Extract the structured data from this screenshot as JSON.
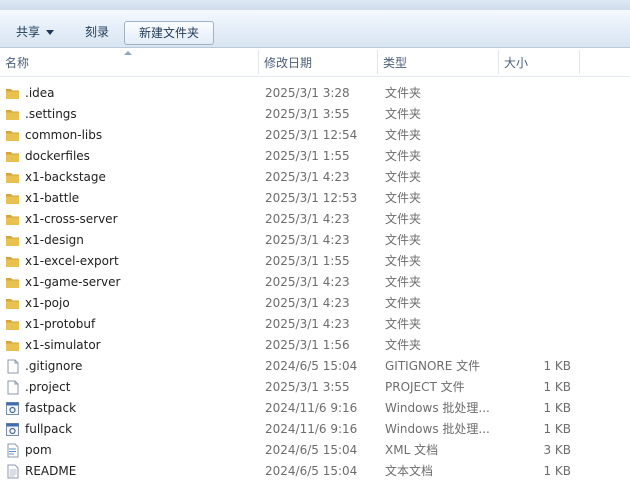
{
  "colors": {
    "folder": "#e9c150",
    "folder_dark": "#d4a53a",
    "toolbar_text": "#1e3956"
  },
  "toolbar": {
    "share_label": "共享",
    "burn_label": "刻录",
    "new_folder_label": "新建文件夹"
  },
  "columns": {
    "name": "名称",
    "modified": "修改日期",
    "type": "类型",
    "size": "大小"
  },
  "files": [
    {
      "name": ".idea",
      "modified": "2025/3/1 3:28",
      "type": "文件夹",
      "size": "",
      "icon": "folder-icon"
    },
    {
      "name": ".settings",
      "modified": "2025/3/1 3:55",
      "type": "文件夹",
      "size": "",
      "icon": "folder-icon"
    },
    {
      "name": "common-libs",
      "modified": "2025/3/1 12:54",
      "type": "文件夹",
      "size": "",
      "icon": "folder-icon"
    },
    {
      "name": "dockerfiles",
      "modified": "2025/3/1 1:55",
      "type": "文件夹",
      "size": "",
      "icon": "folder-icon"
    },
    {
      "name": "x1-backstage",
      "modified": "2025/3/1 4:23",
      "type": "文件夹",
      "size": "",
      "icon": "folder-icon"
    },
    {
      "name": "x1-battle",
      "modified": "2025/3/1 12:53",
      "type": "文件夹",
      "size": "",
      "icon": "folder-icon"
    },
    {
      "name": "x1-cross-server",
      "modified": "2025/3/1 4:23",
      "type": "文件夹",
      "size": "",
      "icon": "folder-icon"
    },
    {
      "name": "x1-design",
      "modified": "2025/3/1 4:23",
      "type": "文件夹",
      "size": "",
      "icon": "folder-icon"
    },
    {
      "name": "x1-excel-export",
      "modified": "2025/3/1 1:55",
      "type": "文件夹",
      "size": "",
      "icon": "folder-icon"
    },
    {
      "name": "x1-game-server",
      "modified": "2025/3/1 4:23",
      "type": "文件夹",
      "size": "",
      "icon": "folder-icon"
    },
    {
      "name": "x1-pojo",
      "modified": "2025/3/1 4:23",
      "type": "文件夹",
      "size": "",
      "icon": "folder-icon"
    },
    {
      "name": "x1-protobuf",
      "modified": "2025/3/1 4:23",
      "type": "文件夹",
      "size": "",
      "icon": "folder-icon"
    },
    {
      "name": "x1-simulator",
      "modified": "2025/3/1 1:56",
      "type": "文件夹",
      "size": "",
      "icon": "folder-icon"
    },
    {
      "name": ".gitignore",
      "modified": "2024/6/5 15:04",
      "type": "GITIGNORE 文件",
      "size": "1 KB",
      "icon": "file-icon"
    },
    {
      "name": ".project",
      "modified": "2025/3/1 3:55",
      "type": "PROJECT 文件",
      "size": "1 KB",
      "icon": "file-icon"
    },
    {
      "name": "fastpack",
      "modified": "2024/11/6 9:16",
      "type": "Windows 批处理...",
      "size": "1 KB",
      "icon": "batch-file-icon"
    },
    {
      "name": "fullpack",
      "modified": "2024/11/6 9:16",
      "type": "Windows 批处理...",
      "size": "1 KB",
      "icon": "batch-file-icon"
    },
    {
      "name": "pom",
      "modified": "2024/6/5 15:04",
      "type": "XML 文档",
      "size": "3 KB",
      "icon": "xml-file-icon"
    },
    {
      "name": "README",
      "modified": "2024/6/5 15:04",
      "type": "文本文档",
      "size": "1 KB",
      "icon": "text-file-icon"
    }
  ]
}
